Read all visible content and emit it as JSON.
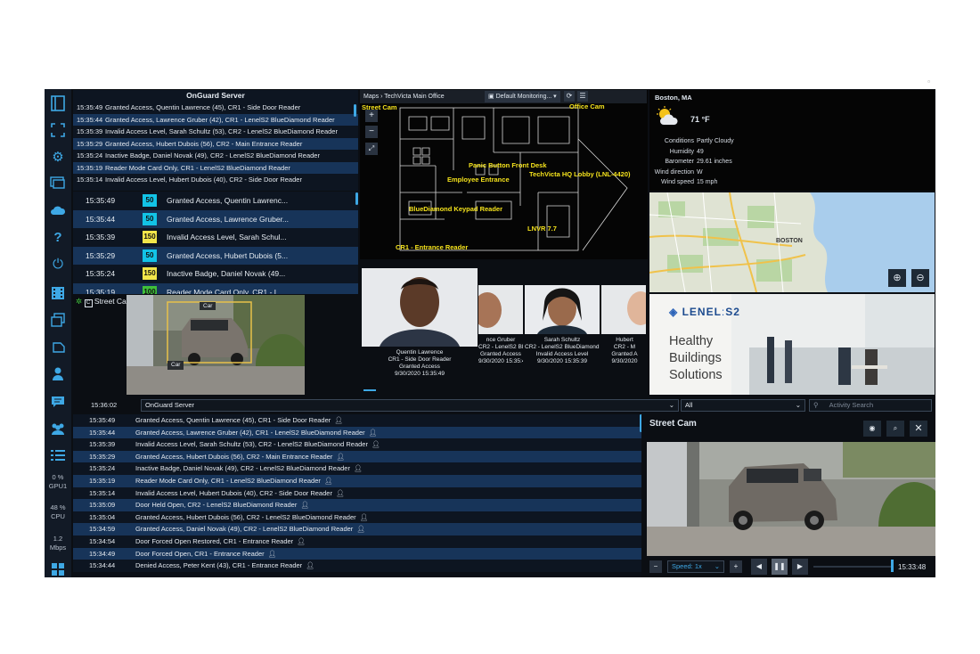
{
  "titlebar": {
    "app_title": ""
  },
  "sidebar": {
    "stats": [
      {
        "value": "0 %",
        "label": "GPU1"
      },
      {
        "value": "48 %",
        "label": "CPU"
      },
      {
        "value": "1.2",
        "label": "Mbps"
      }
    ]
  },
  "onguard_panel": {
    "title": "OnGuard Server",
    "events": [
      {
        "time": "15:35:49",
        "text": "Granted Access, Quentin Lawrence (45), CR1 - Side Door Reader"
      },
      {
        "time": "15:35:44",
        "text": "Granted Access, Lawrence Gruber (42), CR1 - LenelS2 BlueDiamond Reader"
      },
      {
        "time": "15:35:39",
        "text": "Invalid Access Level, Sarah Schultz (53), CR2 - LenelS2 BlueDiamond Reader"
      },
      {
        "time": "15:35:29",
        "text": "Granted Access, Hubert Dubois (56), CR2 - Main Entrance Reader"
      },
      {
        "time": "15:35:24",
        "text": "Inactive Badge, Daniel Novak (49), CR2 - LenelS2 BlueDiamond Reader"
      },
      {
        "time": "15:35:19",
        "text": "Reader Mode Card Only, CR1 - LenelS2 BlueDiamond Reader"
      },
      {
        "time": "15:35:14",
        "text": "Invalid Access Level, Hubert Dubois (40), CR2 - Side Door Reader"
      }
    ]
  },
  "queue_panel": {
    "rows": [
      {
        "time": "15:35:49",
        "badge": "50",
        "badge_color": "#12c3e6",
        "text": "Granted Access, Quentin Lawrenc..."
      },
      {
        "time": "15:35:44",
        "badge": "50",
        "badge_color": "#12c3e6",
        "text": "Granted Access, Lawrence Gruber..."
      },
      {
        "time": "15:35:39",
        "badge": "150",
        "badge_color": "#f2e64a",
        "text": "Invalid Access Level, Sarah Schul..."
      },
      {
        "time": "15:35:29",
        "badge": "50",
        "badge_color": "#12c3e6",
        "text": "Granted Access, Hubert Dubois (5..."
      },
      {
        "time": "15:35:24",
        "badge": "150",
        "badge_color": "#f2e64a",
        "text": "Inactive Badge, Daniel Novak (49..."
      },
      {
        "time": "15:35:19",
        "badge": "100",
        "badge_color": "#3fbf3a",
        "text": "Reader Mode Card Only, CR1 - L..."
      }
    ]
  },
  "street_cam_small": {
    "title": "Street Cam",
    "detect_label_top": "Car",
    "detect_label_bottom": "Car"
  },
  "map_panel": {
    "breadcrumb_root": "Maps",
    "breadcrumb_sep": "›",
    "breadcrumb_current": "TechVicta Main Office",
    "monitoring_label": "Default Monitoring...",
    "labels": [
      "Street Cam",
      "Office Cam",
      "Panic Button Front Desk",
      "TechVicta HQ Lobby (LNL-4420)",
      "Employee Entrance",
      "BlueDiamond Keypad Reader",
      "LNVR 7.7",
      "CR1 - Entrance Reader"
    ]
  },
  "cardholders": {
    "primary": {
      "name": "Quentin Lawrence",
      "reader": "CR1 - Side Door Reader",
      "status": "Granted Access",
      "time": "9/30/2020 15:35:49"
    },
    "second": {
      "name": "nce Gruber",
      "reader": "CR2 - LenelS2 BlueD",
      "status": "Granted Access",
      "time": "9/30/2020 15:35:44"
    },
    "third": {
      "name": "Sarah Schultz",
      "reader": "CR2 - LenelS2 BlueDiamond Re",
      "status": "Invalid Access Level",
      "time": "9/30/2020 15:35:39"
    },
    "fourth": {
      "name": "Hubert",
      "reader": "CR2 - M",
      "status": "Granted A",
      "time": "9/30/2020"
    }
  },
  "weather": {
    "city": "Boston, MA",
    "temp": "71 °F",
    "rows": [
      {
        "k": "Conditions",
        "v": "Partly Cloudy"
      },
      {
        "k": "Humidity",
        "v": "49"
      },
      {
        "k": "Barometer",
        "v": "29.61 inches"
      },
      {
        "k": "Wind direction",
        "v": "W"
      },
      {
        "k": "Wind speed",
        "v": "15 mph"
      }
    ]
  },
  "map_tile": {
    "city_label": "BOSTON"
  },
  "ad": {
    "brand": "LENEL",
    "brand_suffix": "S2",
    "line1": "Healthy",
    "line2": "Buildings",
    "line3": "Solutions"
  },
  "toolbar": {
    "time": "15:36:02",
    "server": "OnGuard Server",
    "filter": "All",
    "search_placeholder": "Activity Search"
  },
  "activity_log": [
    {
      "time": "15:35:49",
      "text": "Granted Access, Quentin Lawrence (45), CR1 - Side Door Reader"
    },
    {
      "time": "15:35:44",
      "text": "Granted Access, Lawrence Gruber (42), CR1 - LenelS2 BlueDiamond Reader"
    },
    {
      "time": "15:35:39",
      "text": "Invalid Access Level, Sarah Schultz (53), CR2 - LenelS2 BlueDiamond Reader"
    },
    {
      "time": "15:35:29",
      "text": "Granted Access, Hubert Dubois (56), CR2 - Main Entrance Reader"
    },
    {
      "time": "15:35:24",
      "text": "Inactive Badge, Daniel Novak (49), CR2 - LenelS2 BlueDiamond Reader"
    },
    {
      "time": "15:35:19",
      "text": "Reader Mode Card Only, CR1 - LenelS2 BlueDiamond Reader"
    },
    {
      "time": "15:35:14",
      "text": "Invalid Access Level, Hubert Dubois (40), CR2 - Side Door Reader"
    },
    {
      "time": "15:35:09",
      "text": "Door Held Open, CR2 - LenelS2 BlueDiamond Reader"
    },
    {
      "time": "15:35:04",
      "text": "Granted Access, Hubert Dubois (56), CR2 - LenelS2 BlueDiamond Reader"
    },
    {
      "time": "15:34:59",
      "text": "Granted Access, Daniel Novak (49), CR2 - LenelS2 BlueDiamond Reader"
    },
    {
      "time": "15:34:54",
      "text": "Door Forced Open Restored, CR1 - Entrance Reader"
    },
    {
      "time": "15:34:49",
      "text": "Door Forced Open, CR1 - Entrance Reader"
    },
    {
      "time": "15:34:44",
      "text": "Denied Access, Peter Kent (43), CR1 - Entrance Reader"
    }
  ],
  "street_cam_large": {
    "title": "Street Cam",
    "speed_label": "Speed: 1x",
    "playback_time": "15:33:48"
  }
}
